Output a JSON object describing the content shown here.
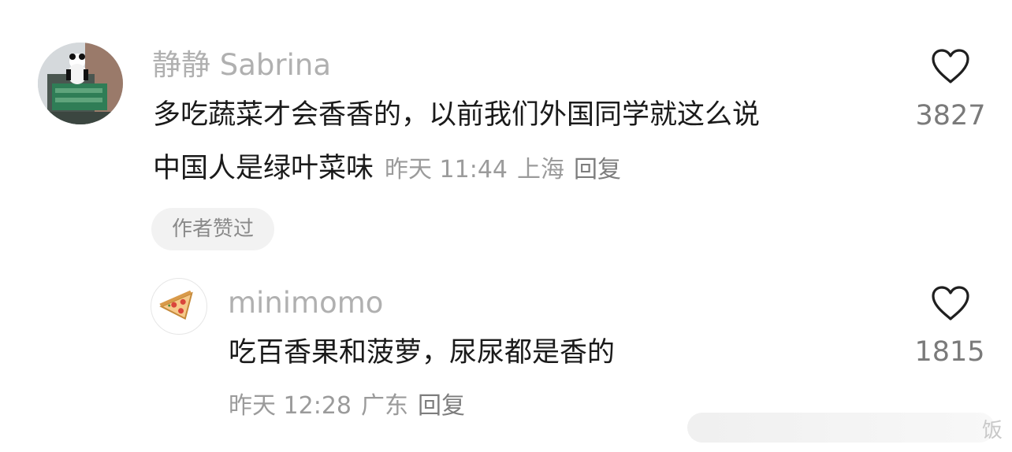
{
  "comment1": {
    "username": "静静 Sabrina",
    "text_line1": "多吃蔬菜才会香香的，以前我们外国同学就这么说",
    "text_line2": "中国人是绿叶菜味",
    "time": "昨天 11:44",
    "location": "上海",
    "reply": "回复",
    "badge": "作者赞过",
    "likes": "3827",
    "avatar_icon": "panda-building-photo"
  },
  "comment2": {
    "username": "minimomo",
    "text": "吃百香果和菠萝，尿尿都是香的",
    "time": "昨天 12:28",
    "location": "广东",
    "reply": "回复",
    "likes": "1815",
    "avatar_icon": "pizza-slice-icon"
  },
  "watermark_text": "饭"
}
